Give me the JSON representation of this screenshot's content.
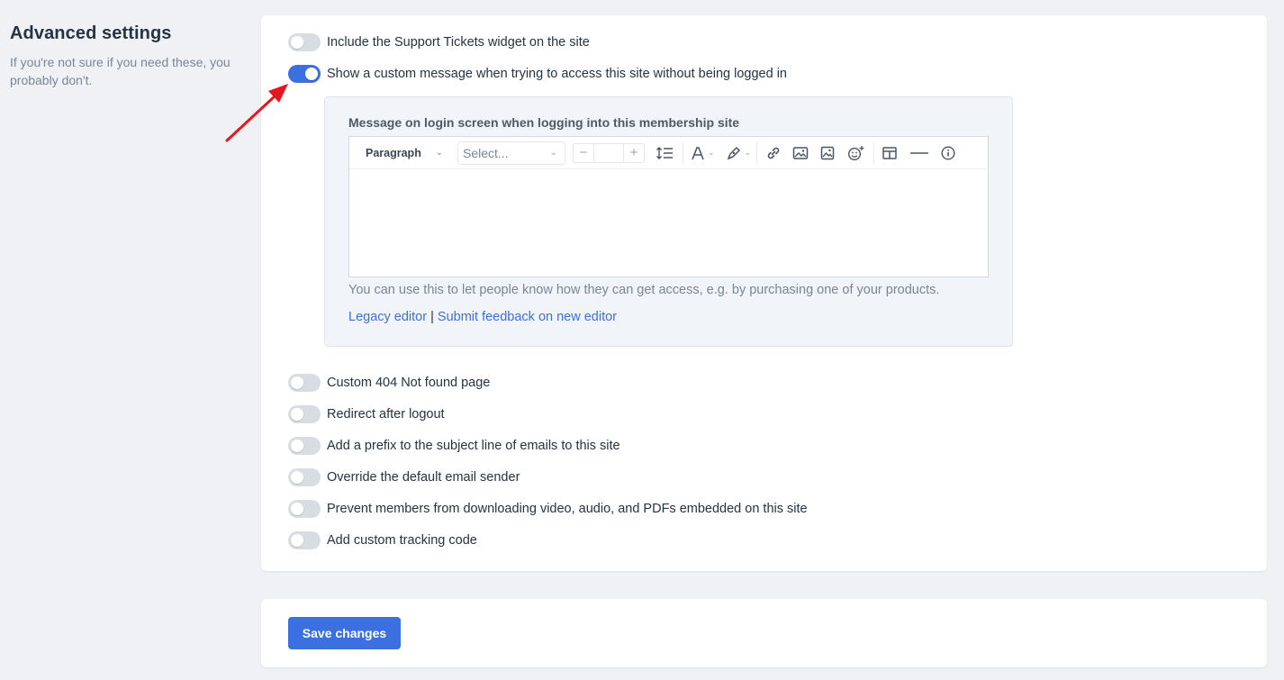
{
  "sidebar": {
    "title": "Advanced settings",
    "description": "If you're not sure if you need these, you probably don't."
  },
  "toggles": [
    {
      "label": "Include the Support Tickets widget on the site",
      "on": false
    },
    {
      "label": "Show a custom message when trying to access this site without being logged in",
      "on": true
    },
    {
      "label": "Custom 404 Not found page",
      "on": false
    },
    {
      "label": "Redirect after logout",
      "on": false
    },
    {
      "label": "Add a prefix to the subject line of emails to this site",
      "on": false
    },
    {
      "label": "Override the default email sender",
      "on": false
    },
    {
      "label": "Prevent members from downloading video, audio, and PDFs embedded on this site",
      "on": false
    },
    {
      "label": "Add custom tracking code",
      "on": false
    }
  ],
  "panel": {
    "title": "Message on login screen when logging into this membership site",
    "hint": "You can use this to let people know how they can get access, e.g. by purchasing one of your products.",
    "legacy_link": "Legacy editor",
    "separator": "|",
    "feedback_link": "Submit feedback on new editor"
  },
  "toolbar": {
    "paragraph": "Paragraph",
    "font_placeholder": "Select...",
    "minus": "−",
    "plus": "+",
    "icons": [
      "line-height-icon",
      "font-color-icon",
      "highlight-icon",
      "link-icon",
      "image-gallery-icon",
      "image-icon",
      "emoji-icon",
      "table-icon",
      "horizontal-rule-icon",
      "info-icon"
    ]
  },
  "footer": {
    "save_label": "Save changes"
  },
  "colors": {
    "accent": "#3c6fe0",
    "annotation_arrow": "#e8141e"
  }
}
